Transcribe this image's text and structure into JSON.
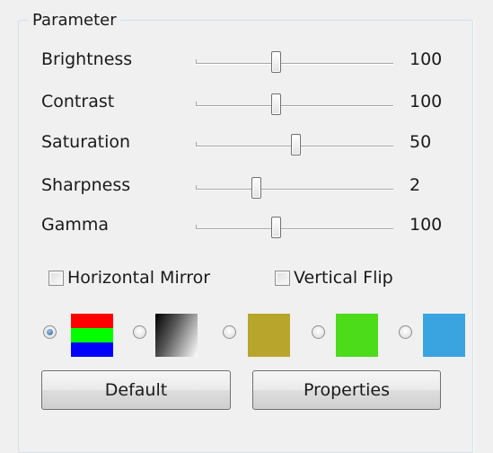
{
  "group": {
    "title": "Parameter"
  },
  "sliders": [
    {
      "label": "Brightness",
      "value": "100"
    },
    {
      "label": "Contrast",
      "value": "100"
    },
    {
      "label": "Saturation",
      "value": "50"
    },
    {
      "label": "Sharpness",
      "value": "2"
    },
    {
      "label": "Gamma",
      "value": "100"
    }
  ],
  "checkboxes": [
    {
      "label": "Horizontal Mirror",
      "checked": false
    },
    {
      "label": "Vertical Flip",
      "checked": false
    }
  ],
  "color_presets": {
    "selected_index": 0,
    "swatches": [
      {
        "name": "rgb-bars",
        "colors": [
          "#ff0000",
          "#00ff00",
          "#0000ff"
        ]
      },
      {
        "name": "gradient",
        "colors": [
          "#000000",
          "#ffffff"
        ]
      },
      {
        "name": "gold",
        "colors": [
          "#b8a52c"
        ]
      },
      {
        "name": "green",
        "colors": [
          "#4cdc1a"
        ]
      },
      {
        "name": "blue",
        "colors": [
          "#3aa4e0"
        ]
      }
    ]
  },
  "buttons": {
    "default_label": "Default",
    "properties_label": "Properties"
  }
}
